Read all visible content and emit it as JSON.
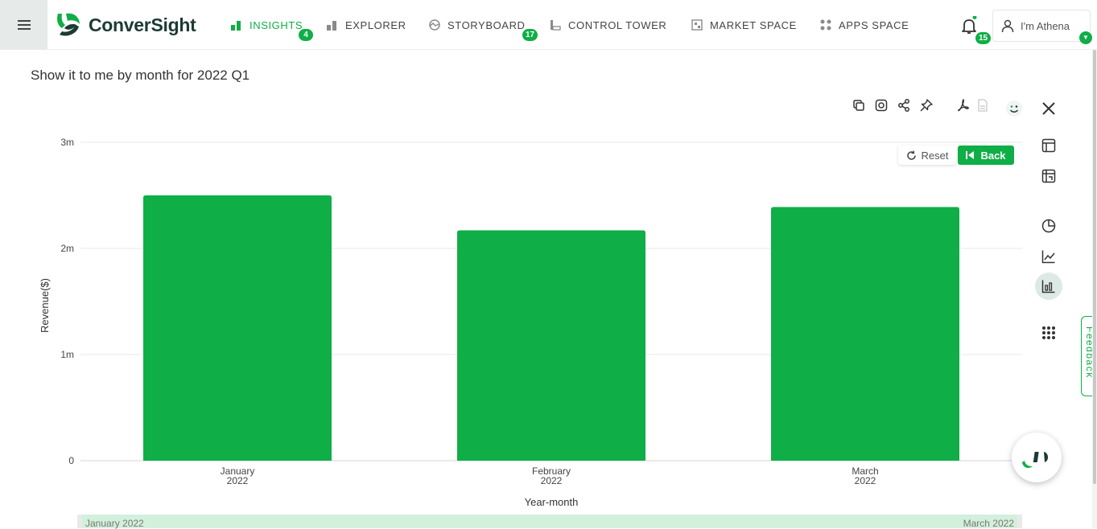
{
  "app": {
    "brand": "ConverSight"
  },
  "nav": [
    {
      "label": "INSIGHTS",
      "badge": "4",
      "icon": "bar-chart-icon",
      "active": true
    },
    {
      "label": "EXPLORER",
      "badge": "",
      "icon": "explorer-icon",
      "active": false
    },
    {
      "label": "STORYBOARD",
      "badge": "17",
      "icon": "storyboard-icon",
      "active": false
    },
    {
      "label": "CONTROL TOWER",
      "badge": "",
      "icon": "control-tower-icon",
      "active": false
    },
    {
      "label": "MARKET SPACE",
      "badge": "",
      "icon": "market-space-icon",
      "active": false
    },
    {
      "label": "APPS SPACE",
      "badge": "",
      "icon": "apps-icon",
      "active": false
    }
  ],
  "notifications": {
    "count": "15"
  },
  "user": {
    "label": "I'm Athena"
  },
  "query": {
    "text": "Show it to me by month for 2022 Q1"
  },
  "buttons": {
    "reset": "Reset",
    "back": "Back"
  },
  "feedback": {
    "label": "Feedback"
  },
  "colors": {
    "accent": "#0fae46",
    "bar": "#0fae46",
    "dark": "#1d3b35"
  },
  "range_slider": {
    "start": "January 2022",
    "end": "March 2022"
  },
  "chart_data": {
    "type": "bar",
    "categories": [
      [
        "January",
        "2022"
      ],
      [
        "February",
        "2022"
      ],
      [
        "March",
        "2022"
      ]
    ],
    "values": [
      2500000,
      2170000,
      2390000
    ],
    "xlabel": "Year-month",
    "ylabel": "Revenue($)",
    "ylim": [
      0,
      3000000
    ],
    "yticks": [
      0,
      1000000,
      2000000,
      3000000
    ],
    "ytick_labels": [
      "0",
      "1m",
      "2m",
      "3m"
    ],
    "grid": true,
    "color": "#0fae46"
  }
}
